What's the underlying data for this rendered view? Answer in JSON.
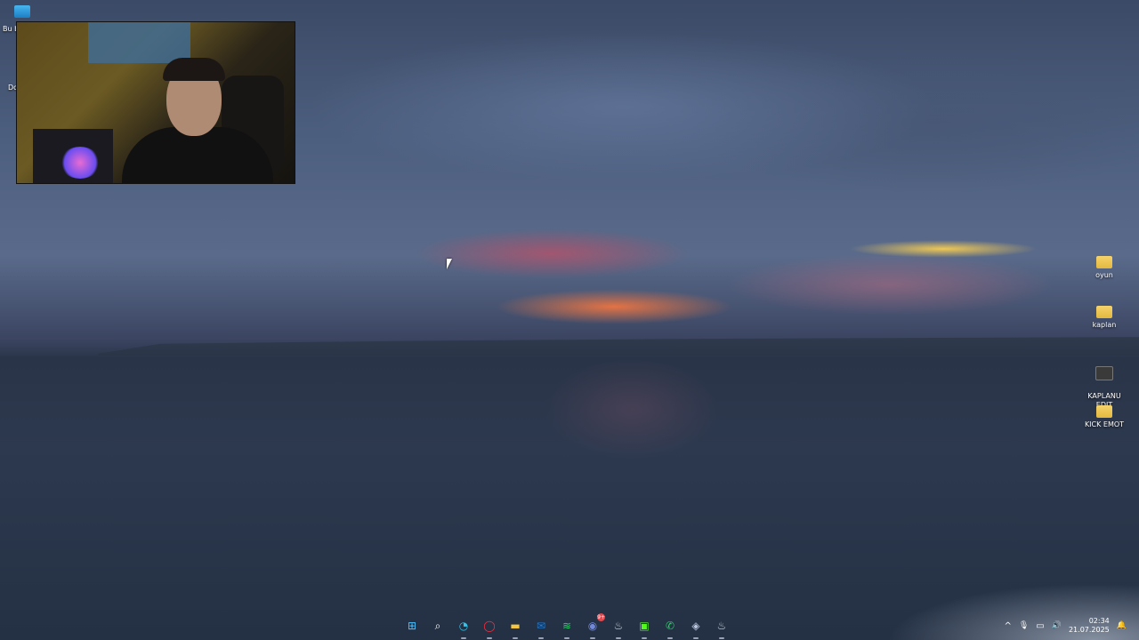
{
  "desktop": {
    "left_icons": [
      {
        "label": "Bu b"
      },
      {
        "label": "Do"
      }
    ],
    "right_icons": [
      {
        "label": "oyun",
        "icon": "folder-icon"
      },
      {
        "label": "kaplan",
        "icon": "folder-icon"
      },
      {
        "label": "KAPLANU\nEDIT",
        "icon": "shortcut-icon"
      },
      {
        "label": "KICK EMOT",
        "icon": "folder-icon"
      }
    ]
  },
  "taskbar": {
    "apps": [
      {
        "name": "start",
        "glyph": "⊞",
        "color": "#4cc2ff"
      },
      {
        "name": "search",
        "glyph": "⌕",
        "color": "#ffffff"
      },
      {
        "name": "edge",
        "glyph": "◔",
        "color": "#35c4e8"
      },
      {
        "name": "opera",
        "glyph": "◯",
        "color": "#ff2d3f"
      },
      {
        "name": "file-explorer",
        "glyph": "▬",
        "color": "#f5c542"
      },
      {
        "name": "outlook",
        "glyph": "✉",
        "color": "#1f7cd6"
      },
      {
        "name": "spotify",
        "glyph": "≋",
        "color": "#1ed760"
      },
      {
        "name": "discord",
        "glyph": "◉",
        "color": "#7289da",
        "badge": "9+"
      },
      {
        "name": "steam",
        "glyph": "♨",
        "color": "#c7d5e0"
      },
      {
        "name": "kick",
        "glyph": "▣",
        "color": "#53fc18"
      },
      {
        "name": "whatsapp",
        "glyph": "✆",
        "color": "#25d366"
      },
      {
        "name": "app-network",
        "glyph": "◈",
        "color": "#b9c6dd"
      },
      {
        "name": "steam-2",
        "glyph": "♨",
        "color": "#c7d5e0"
      }
    ],
    "tray": {
      "chevron": "^",
      "mic": "🎙",
      "network": "▭",
      "volume": "🔊",
      "time": "02:34",
      "date": "21.07.2025",
      "notification": "🔔"
    }
  }
}
